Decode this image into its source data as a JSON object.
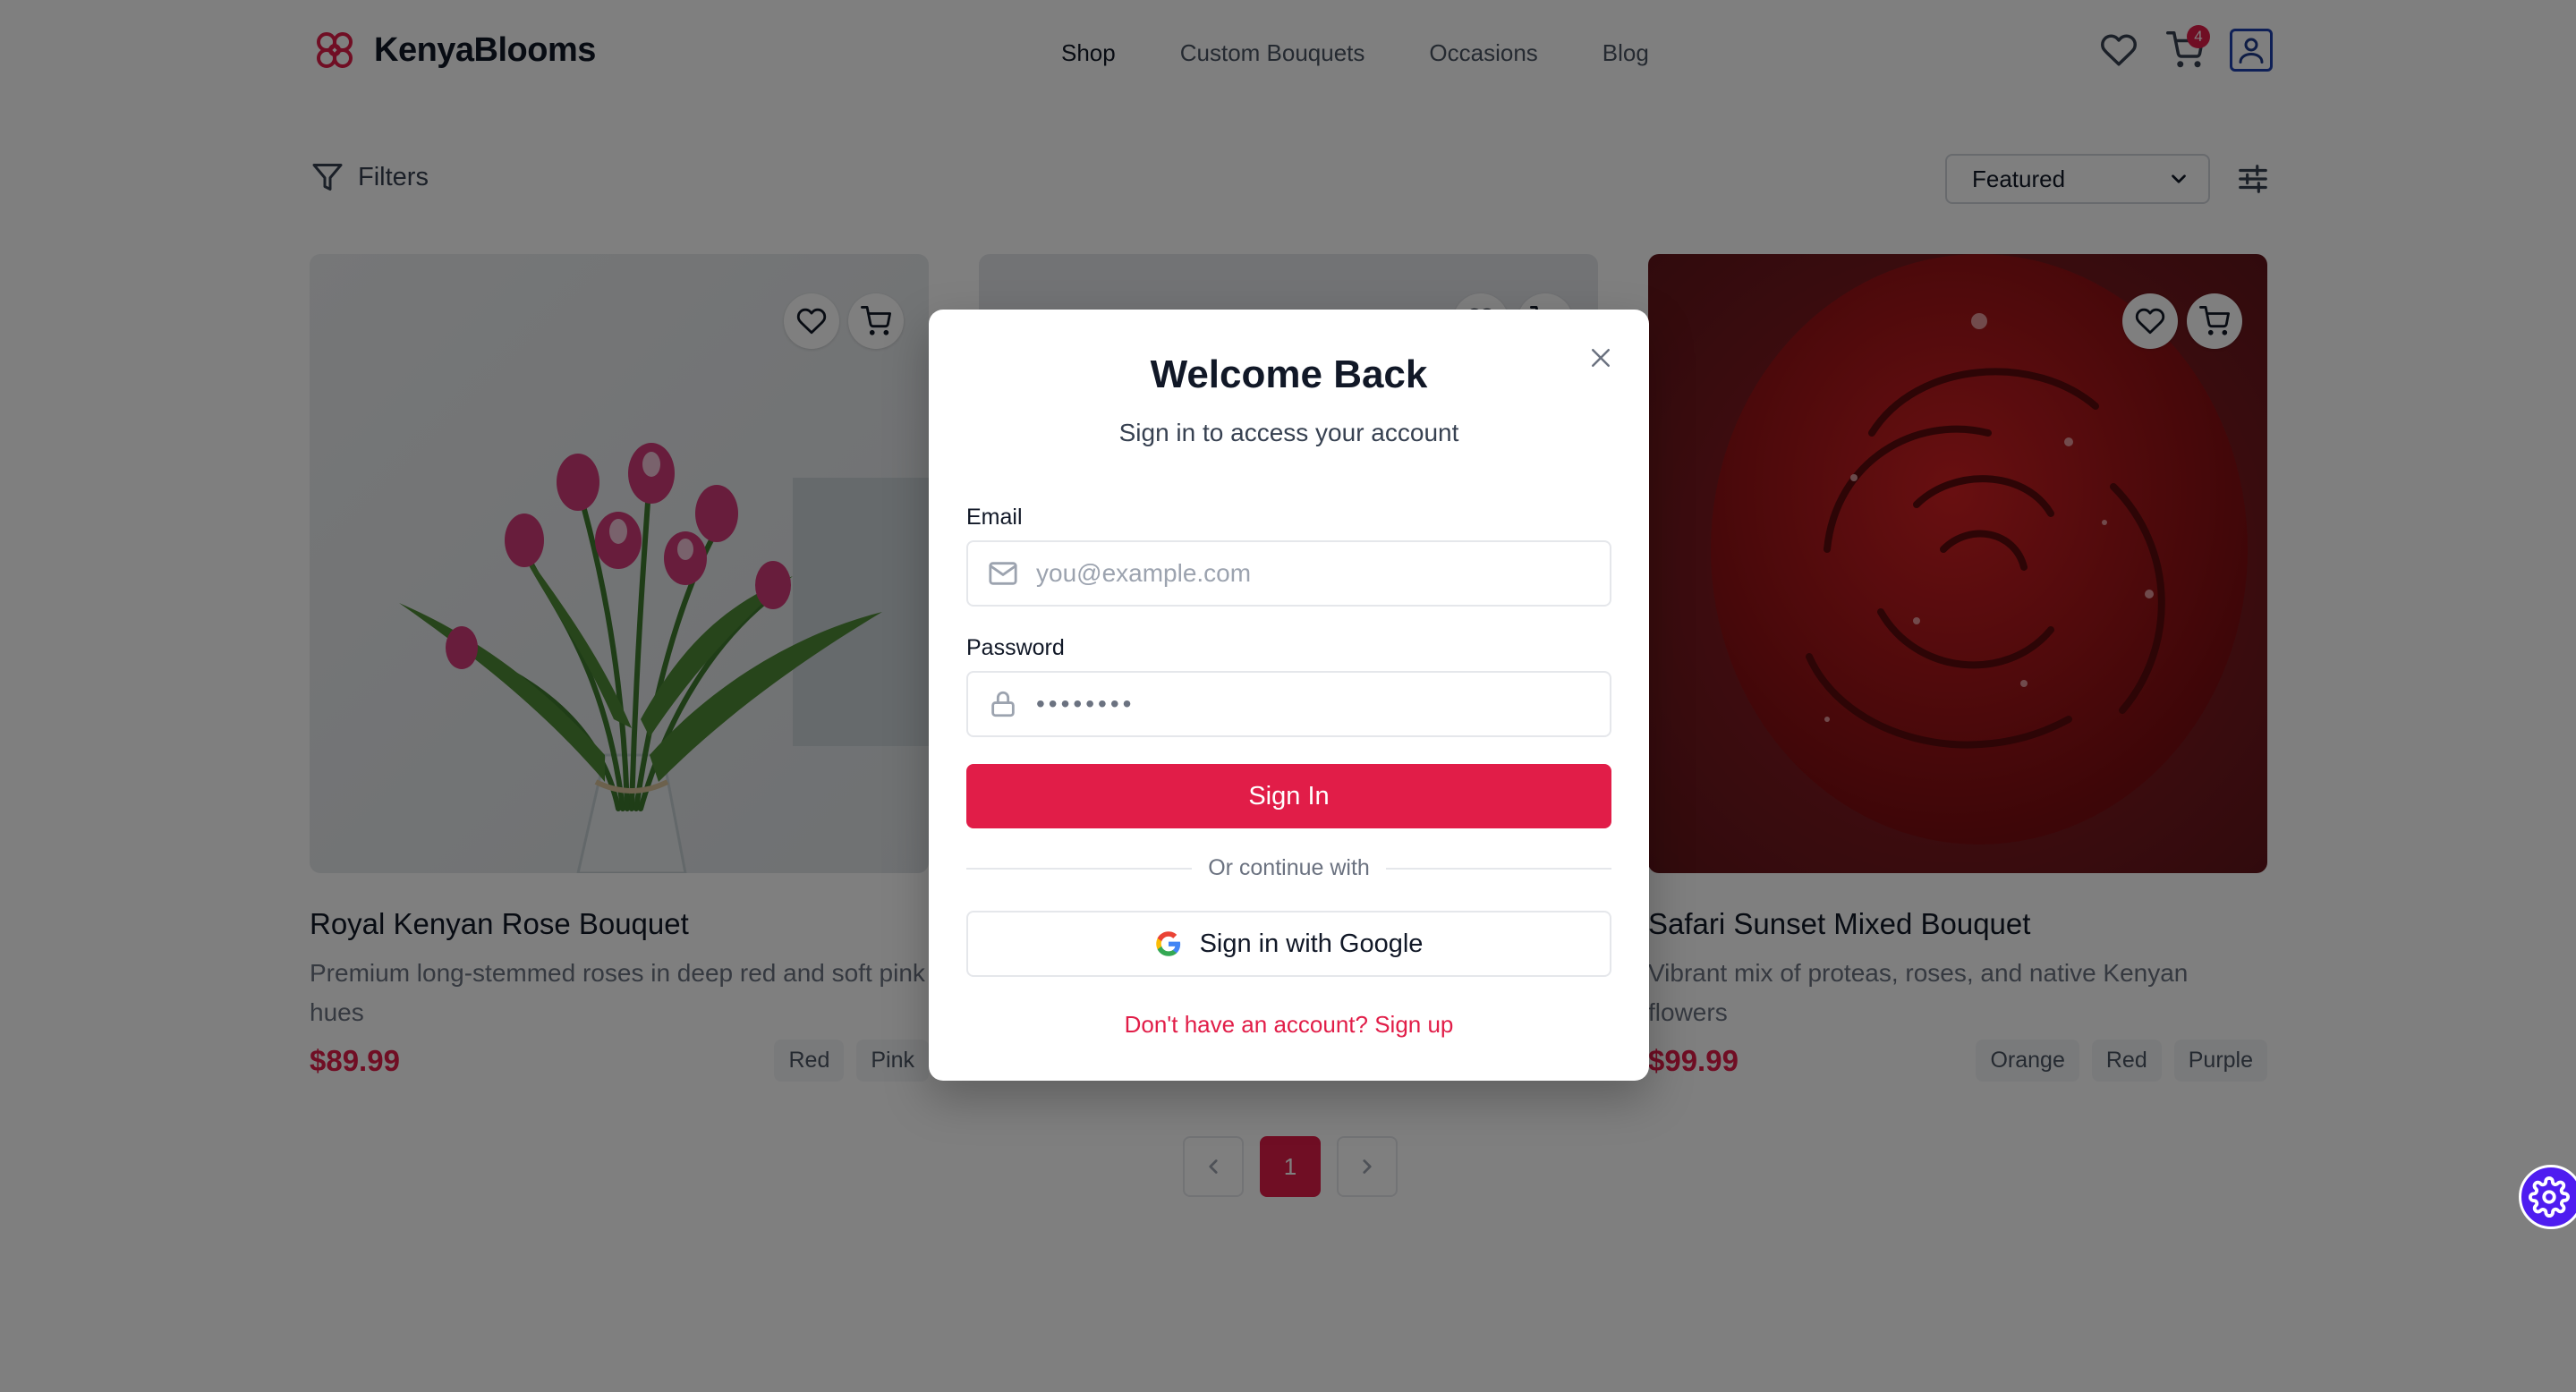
{
  "header": {
    "brand": "KenyaBlooms",
    "nav": [
      "Shop",
      "Custom Bouquets",
      "Occasions",
      "Blog"
    ],
    "cart_count": "4"
  },
  "toolbar": {
    "filters_label": "Filters",
    "sort_selected": "Featured"
  },
  "products": [
    {
      "title": "Royal Kenyan Rose Bouquet",
      "description": "Premium long-stemmed roses in deep red and soft pink hues",
      "price": "$89.99",
      "tags": [
        "Red",
        "Pink"
      ]
    },
    {
      "title": "Safari Sunset Mixed Bouquet",
      "description": "Vibrant mix of proteas, roses, and native Kenyan flowers",
      "price": "$99.99",
      "tags": [
        "Orange",
        "Red",
        "Purple"
      ]
    }
  ],
  "pagination": {
    "current_page": "1"
  },
  "modal": {
    "title": "Welcome Back",
    "subtitle": "Sign in to access your account",
    "email_label": "Email",
    "email_placeholder": "you@example.com",
    "password_label": "Password",
    "password_value": "••••••••",
    "signin_label": "Sign In",
    "divider_text": "Or continue with",
    "google_label": "Sign in with Google",
    "signup_text": "Don't have an account? Sign up"
  },
  "colors": {
    "accent": "#e11d48",
    "fab": "#4f1df0",
    "profile_border": "#1e40af"
  },
  "icons": [
    "flower-logo-icon",
    "heart-icon",
    "cart-icon",
    "user-icon",
    "filter-icon",
    "chevron-down-icon",
    "sliders-icon",
    "close-icon",
    "mail-icon",
    "lock-icon",
    "google-icon",
    "chevron-left-icon",
    "chevron-right-icon",
    "gear-icon"
  ]
}
